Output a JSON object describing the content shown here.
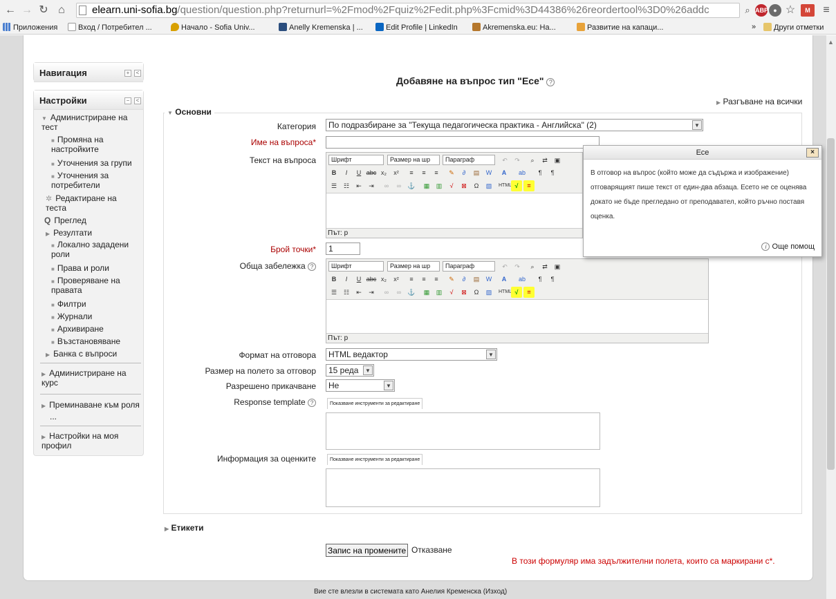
{
  "browser": {
    "url_host": "elearn.uni-sofia.bg",
    "url_rest": "/question/question.php?returnurl=%2Fmod%2Fquiz%2Fedit.php%3Fcmid%3D44386%26reordertool%3D0%26addc",
    "bookmarks": [
      "Приложения",
      "Вход / Потребител ...",
      "Начало - Sofia Univ...",
      "Anelly Kremenska | ...",
      "Edit Profile | LinkedIn",
      "Akremenska.eu: На...",
      "Развитие на капаци..."
    ],
    "other_bookmarks": "Други отметки",
    "more": "»"
  },
  "sidebar": {
    "nav_title": "Навигация",
    "settings_title": "Настройки",
    "items": [
      {
        "label": "Администриране на тест",
        "kind": "open"
      },
      {
        "label": "Промяна на настройките",
        "kind": "bullet"
      },
      {
        "label": "Уточнения за групи",
        "kind": "bullet"
      },
      {
        "label": "Уточнения за потребители",
        "kind": "bullet"
      },
      {
        "label": "Редактиране на теста",
        "kind": "gear"
      },
      {
        "label": "Преглед",
        "kind": "search"
      },
      {
        "label": "Резултати",
        "kind": "arrow"
      },
      {
        "label": "Локално зададени роли",
        "kind": "bullet"
      },
      {
        "label": "Права и роли",
        "kind": "bullet"
      },
      {
        "label": "Проверяване на правата",
        "kind": "bullet"
      },
      {
        "label": "Филтри",
        "kind": "bullet"
      },
      {
        "label": "Журнали",
        "kind": "bullet"
      },
      {
        "label": "Архивиране",
        "kind": "bullet"
      },
      {
        "label": "Възстановяване",
        "kind": "bullet"
      },
      {
        "label": "Банка с въпроси",
        "kind": "arrow"
      }
    ],
    "section2": "Администриране на курс",
    "section3a": "Преминаване към роля",
    "section3b": "...",
    "section4": "Настройки на моя профил"
  },
  "form": {
    "heading": "Добавяне на въпрос тип \"Есе\"",
    "expand_all": "Разгъване на всички",
    "legend": "Основни",
    "category_label": "Категория",
    "category_value": "По подразбиране за \"Текуща педагогическа практика - Английска\" (2)",
    "name_label": "Име на въпроса*",
    "name_value": "",
    "text_label": "Текст на въпроса",
    "points_label": "Брой точки*",
    "points_value": "1",
    "feedback_label": "Обща забележка",
    "editor_font": "Шрифт",
    "editor_size": "Размер на шр",
    "editor_format": "Параграф",
    "editor_path": "Път: p",
    "format_label": "Формат на отговора",
    "format_value": "HTML ведактор",
    "size_label": "Размер на полето за отговор",
    "size_value": "15 реда",
    "attach_label": "Разрешено прикачване",
    "attach_value": "Не",
    "template_label": "Response template",
    "show_tools": "Показване инструменти за редактиране",
    "grading_label": "Информация за оценките",
    "tags_label": "Етикети",
    "save_label": "Запис на промените",
    "cancel_label": "Отказване",
    "required_note": "В този формуляр има задължителни полета, които са маркирани с*."
  },
  "popup": {
    "title": "Есе",
    "close": "×",
    "body": "В отговор на въпрос (който може да съдържа и изображение) отговарящият пише текст от един-два абзаца. Есето не се оценява докато не бъде прегледано от преподавател, който ръчно поставя оценка.",
    "more_help": "Още помощ"
  },
  "footer": {
    "login_text": "Вие сте влезли в системата като Анелия Кременска (Изход)"
  },
  "colors": {
    "required": "#aa0000",
    "block_bg": "#f2f2f2",
    "page_bg": "#dcdcdc"
  }
}
